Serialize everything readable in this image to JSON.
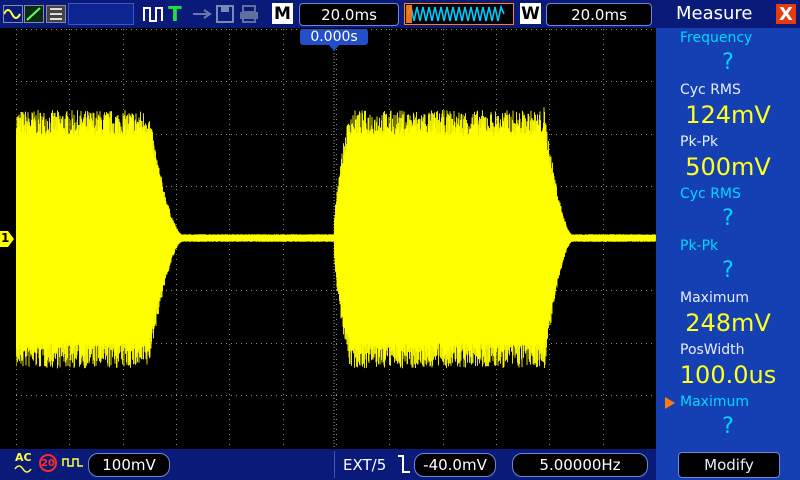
{
  "top": {
    "trigger_letter": "T",
    "main_badge": "M",
    "main_timebase": "20.0ms",
    "window_badge": "W",
    "window_timebase": "20.0ms"
  },
  "trigger_position": "0.000s",
  "channel": {
    "marker": "1",
    "coupling": "AC",
    "bw_limit": "20",
    "scale": "100mV"
  },
  "trigger": {
    "source": "EXT/5",
    "level": "-40.0mV",
    "frequency": "5.00000Hz"
  },
  "panel": {
    "title": "Measure",
    "close": "X",
    "items": [
      {
        "label": "Frequency",
        "value": "?"
      },
      {
        "label": "Cyc RMS",
        "value": "124mV"
      },
      {
        "label": "Pk-Pk",
        "value": "500mV"
      },
      {
        "label": "Cyc RMS",
        "value": "?"
      },
      {
        "label": "Pk-Pk",
        "value": "?"
      },
      {
        "label": "Maximum",
        "value": "248mV"
      },
      {
        "label": "PosWidth",
        "value": "100.0us"
      },
      {
        "label": "Maximum",
        "value": "?"
      }
    ],
    "modify": "Modify"
  },
  "colors": {
    "trace": "#ffff00",
    "grid": "#8a8a8a",
    "topbar": "#0a1a78",
    "panel": "#1540b4",
    "accent": "#ff7a10"
  },
  "icons": [
    "run-mode-icon",
    "waveform-icon",
    "printer-icon",
    "trigger-pulse-icon",
    "save-icon",
    "usb-icon"
  ]
}
